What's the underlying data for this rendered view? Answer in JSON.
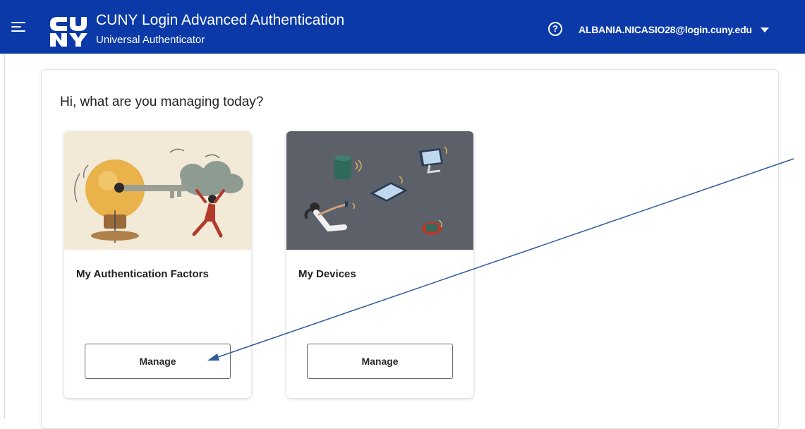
{
  "header": {
    "logo_text": "CUNY",
    "app_title": "CUNY Login Advanced Authentication",
    "app_subtitle": "Universal Authenticator",
    "help_icon_glyph": "?",
    "user_email": "ALBANIA.NICASIO28@login.cuny.edu",
    "background_color": "#0b3aa8",
    "icons": [
      "menu-icon",
      "cuny-logo",
      "help-icon",
      "caret-down-icon"
    ]
  },
  "main": {
    "greeting": "Hi, what are you managing today?",
    "cards": [
      {
        "title": "My Authentication Factors",
        "button_label": "Manage",
        "illustration": "lightbulb-key-cloud"
      },
      {
        "title": "My Devices",
        "button_label": "Manage",
        "illustration": "connected-devices"
      }
    ]
  },
  "annotation": {
    "type": "arrow",
    "color": "#2e5c9a",
    "points_to": "My Authentication Factors Manage button"
  }
}
